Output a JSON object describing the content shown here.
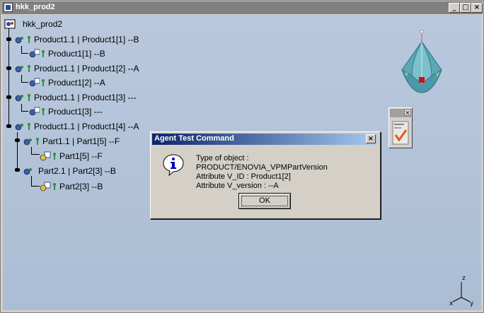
{
  "window": {
    "title": "hkk_prod2",
    "min_glyph": "_",
    "max_glyph": "□",
    "close_glyph": "×"
  },
  "tree": {
    "root": "hkk_prod2",
    "nodes": [
      {
        "label": "Product1.1 | Product1[1] --B",
        "icon": "product-icon"
      },
      {
        "label": "Product1[1] --B",
        "icon": "product-reference-icon"
      },
      {
        "label": "Product1.1 | Product1[2] --A",
        "icon": "product-icon"
      },
      {
        "label": "Product1[2] --A",
        "icon": "product-reference-icon"
      },
      {
        "label": "Product1.1 | Product1[3] ---",
        "icon": "product-icon"
      },
      {
        "label": "Product1[3] ---",
        "icon": "product-reference-icon"
      },
      {
        "label": "Product1.1 | Product1[4] --A",
        "icon": "product-icon"
      },
      {
        "label": "Part1.1 | Part1[5] --F",
        "icon": "part-instance-icon"
      },
      {
        "label": "Part1[5] --F",
        "icon": "part-icon"
      },
      {
        "label": "Part2.1 | Part2[3] --B",
        "icon": "part-instance-icon"
      },
      {
        "label": "Part2[3] --B",
        "icon": "part-icon"
      }
    ]
  },
  "compass": {
    "icon": "compass-icon"
  },
  "toolbox": {
    "icon": "checkmark-tool-icon",
    "close_glyph": "×"
  },
  "axis": {
    "x": "x",
    "y": "y",
    "z": "z"
  },
  "dialog": {
    "title": "Agent Test Command",
    "close_glyph": "×",
    "icon": "info-icon",
    "lines": [
      "Type of object : PRODUCT/ENOVIA_VPMPartVersion",
      "Attribute V_ID : Product1[2]",
      "Attribute V_version : --A"
    ],
    "ok_label": "OK"
  },
  "colors": {
    "viewport_bg": "#b9c8dd",
    "dialog_title_start": "#0a246a",
    "dialog_title_end": "#a6caf0",
    "compass_fill": "#5aa8b8"
  }
}
